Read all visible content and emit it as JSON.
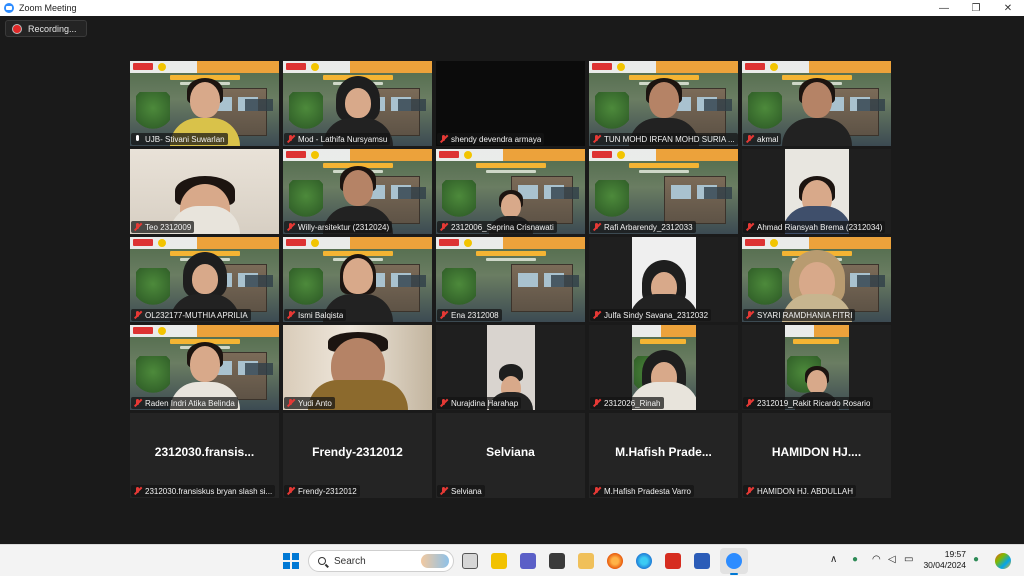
{
  "window": {
    "title": "Zoom Meeting",
    "minimize": "—",
    "restore": "❐",
    "close": "✕"
  },
  "recording": {
    "label": "Recording..."
  },
  "tiles": [
    {
      "name": "UJB- Stivani Suwarlan",
      "mic": "on"
    },
    {
      "name": "Mod - Lathifa Nursyamsu",
      "mic": "muted"
    },
    {
      "name": "shendy devendra armaya",
      "mic": "muted"
    },
    {
      "name": "TUN MOHD IRFAN MOHD SURIA ...",
      "mic": "muted"
    },
    {
      "name": "akmal",
      "mic": "muted"
    },
    {
      "name": "Teo 2312009",
      "mic": "muted"
    },
    {
      "name": "Willy-arsitektur (2312024)",
      "mic": "muted"
    },
    {
      "name": "2312006_Seprina Crisnawati",
      "mic": "muted"
    },
    {
      "name": "Rafi Arbarendy_2312033",
      "mic": "muted"
    },
    {
      "name": "Ahmad Riansyah Brema (2312034)",
      "mic": "muted"
    },
    {
      "name": "OL232177-MUTHIA APRILIA",
      "mic": "muted"
    },
    {
      "name": "Ismi Balqista",
      "mic": "muted"
    },
    {
      "name": "Ena 2312008",
      "mic": "muted"
    },
    {
      "name": "Julfa Sindy Savana_2312032",
      "mic": "muted"
    },
    {
      "name": "SYARI RAMDHANIA FITRI",
      "mic": "muted"
    },
    {
      "name": "Raden Indri Atika Belinda",
      "mic": "muted"
    },
    {
      "name": "Yudi Anto",
      "mic": "muted"
    },
    {
      "name": "Nurajdina Harahap",
      "mic": "muted"
    },
    {
      "name": "2312026_Rinah",
      "mic": "muted"
    },
    {
      "name": "2312019_Rakit Ricardo Rosario",
      "mic": "muted"
    },
    {
      "name": "2312030.fransiskus bryan slash si...",
      "display": "2312030.fransis...",
      "mic": "muted"
    },
    {
      "name": "Frendy-2312012",
      "display": "Frendy-2312012",
      "mic": "muted"
    },
    {
      "name": "Selviana",
      "display": "Selviana",
      "mic": "muted"
    },
    {
      "name": "M.Hafish Pradesta Varro",
      "display": "M.Hafish  Prade...",
      "mic": "muted"
    },
    {
      "name": "HAMIDON HJ. ABDULLAH",
      "display": "HAMIDON  HJ....",
      "mic": "muted"
    }
  ],
  "taskbar": {
    "search_label": "Search",
    "time": "19:57",
    "date": "30/04/2024",
    "tray_chevron": "∧"
  },
  "colors": {
    "active_speaker_border": "#9acd32",
    "muted_mic": "#e53935",
    "windows_accent": "#0078d4"
  }
}
